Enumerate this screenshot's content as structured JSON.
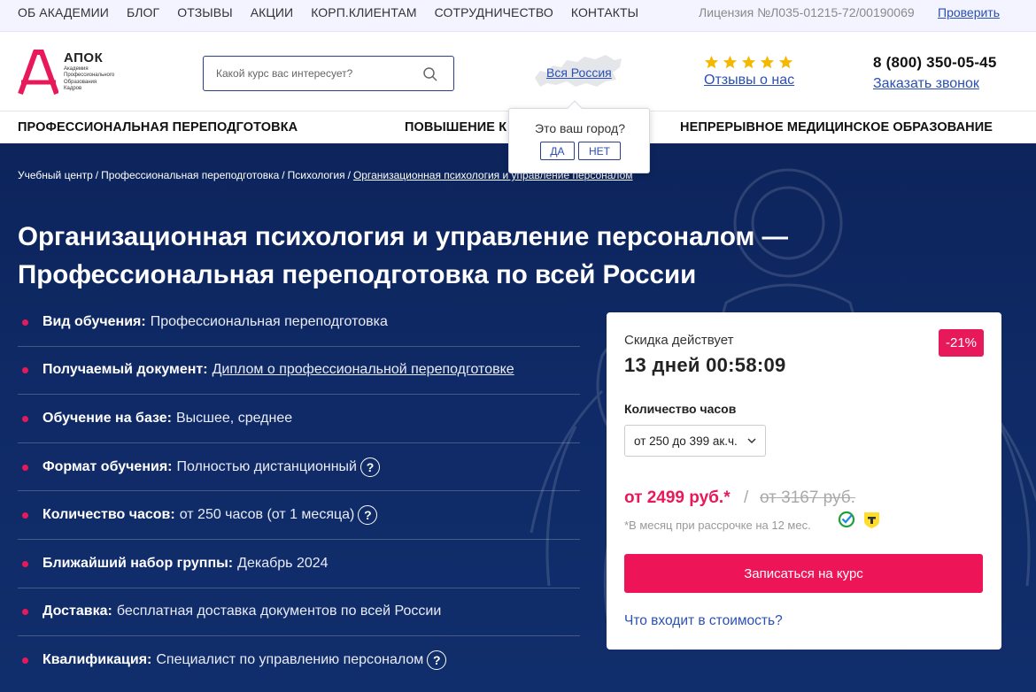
{
  "topbar": {
    "nav": [
      "ОБ АКАДЕМИИ",
      "БЛОГ",
      "ОТЗЫВЫ",
      "АКЦИИ",
      "КОРП.КЛИЕНТАМ",
      "СОТРУДНИЧЕСТВО",
      "КОНТАКТЫ"
    ],
    "license": "Лицензия №Л035-01215-72/00190069",
    "verify": "Проверить"
  },
  "header": {
    "logo_name": "АПОК",
    "logo_sub": [
      "Академия",
      "Профессионального",
      "Образования",
      "Кадров"
    ],
    "search_placeholder": "Какой курс вас интересует?",
    "region": "Вся Россия",
    "rating_stars": 5,
    "reviews": "Отзывы о нас",
    "phone": "8 (800) 350-05-45",
    "callback": "Заказать звонок"
  },
  "categories": [
    "ПРОФЕССИОНАЛЬНАЯ ПЕРЕПОДГОТОВКА",
    "ПОВЫШЕНИЕ К",
    "НЕПРЕРЫВНОЕ МЕДИЦИНСКОЕ ОБРАЗОВАНИЕ"
  ],
  "city_popup": {
    "question": "Это ваш город?",
    "yes": "ДА",
    "no": "НЕТ"
  },
  "breadcrumb": [
    "Учебный центр",
    "Профессиональная переподготовка",
    "Психология",
    "Организационная психология и управление персоналом"
  ],
  "breadcrumb_sep": "/",
  "title_line1": "Организационная психология и управление персоналом —",
  "title_line2": "Профессиональная переподготовка по всей России",
  "facts": [
    {
      "label": "Вид обучения:",
      "value": "Профессиональная переподготовка"
    },
    {
      "label": "Получаемый документ:",
      "value": "Диплом о профессиональной переподготовке"
    },
    {
      "label": "Обучение на базе:",
      "value": "Высшее, среднее"
    },
    {
      "label": "Формат обучения:",
      "value": "Полностью дистанционный"
    },
    {
      "label": "Количество часов:",
      "value": "от 250 часов (от 1 месяца)"
    },
    {
      "label": "Ближайший набор группы:",
      "value": "Декабрь 2024"
    },
    {
      "label": "Доставка:",
      "value": "бесплатная доставка документов по всей России"
    },
    {
      "label": "Квалификация:",
      "value": "Специалист по управлению персоналом"
    }
  ],
  "help_glyph": "?",
  "card": {
    "discount_label": "Скидка действует",
    "timer": "13 дней 00:58:09",
    "badge": "-21%",
    "hours_label": "Количество часов",
    "hours_value": "от 250 до 399 ак.ч.",
    "price": "от 2499 руб.*",
    "slash": "/",
    "old_price": "от 3167 руб.",
    "installment": "*В месяц при рассрочке на 12 мес.",
    "cta": "Записаться на курс",
    "included": "Что входит в стоимость?"
  },
  "colors": {
    "accent": "#e8195a",
    "link": "#2a4fb5",
    "hero_bg": "#0f2a66",
    "topbar_bg": "#f3f4ff"
  }
}
